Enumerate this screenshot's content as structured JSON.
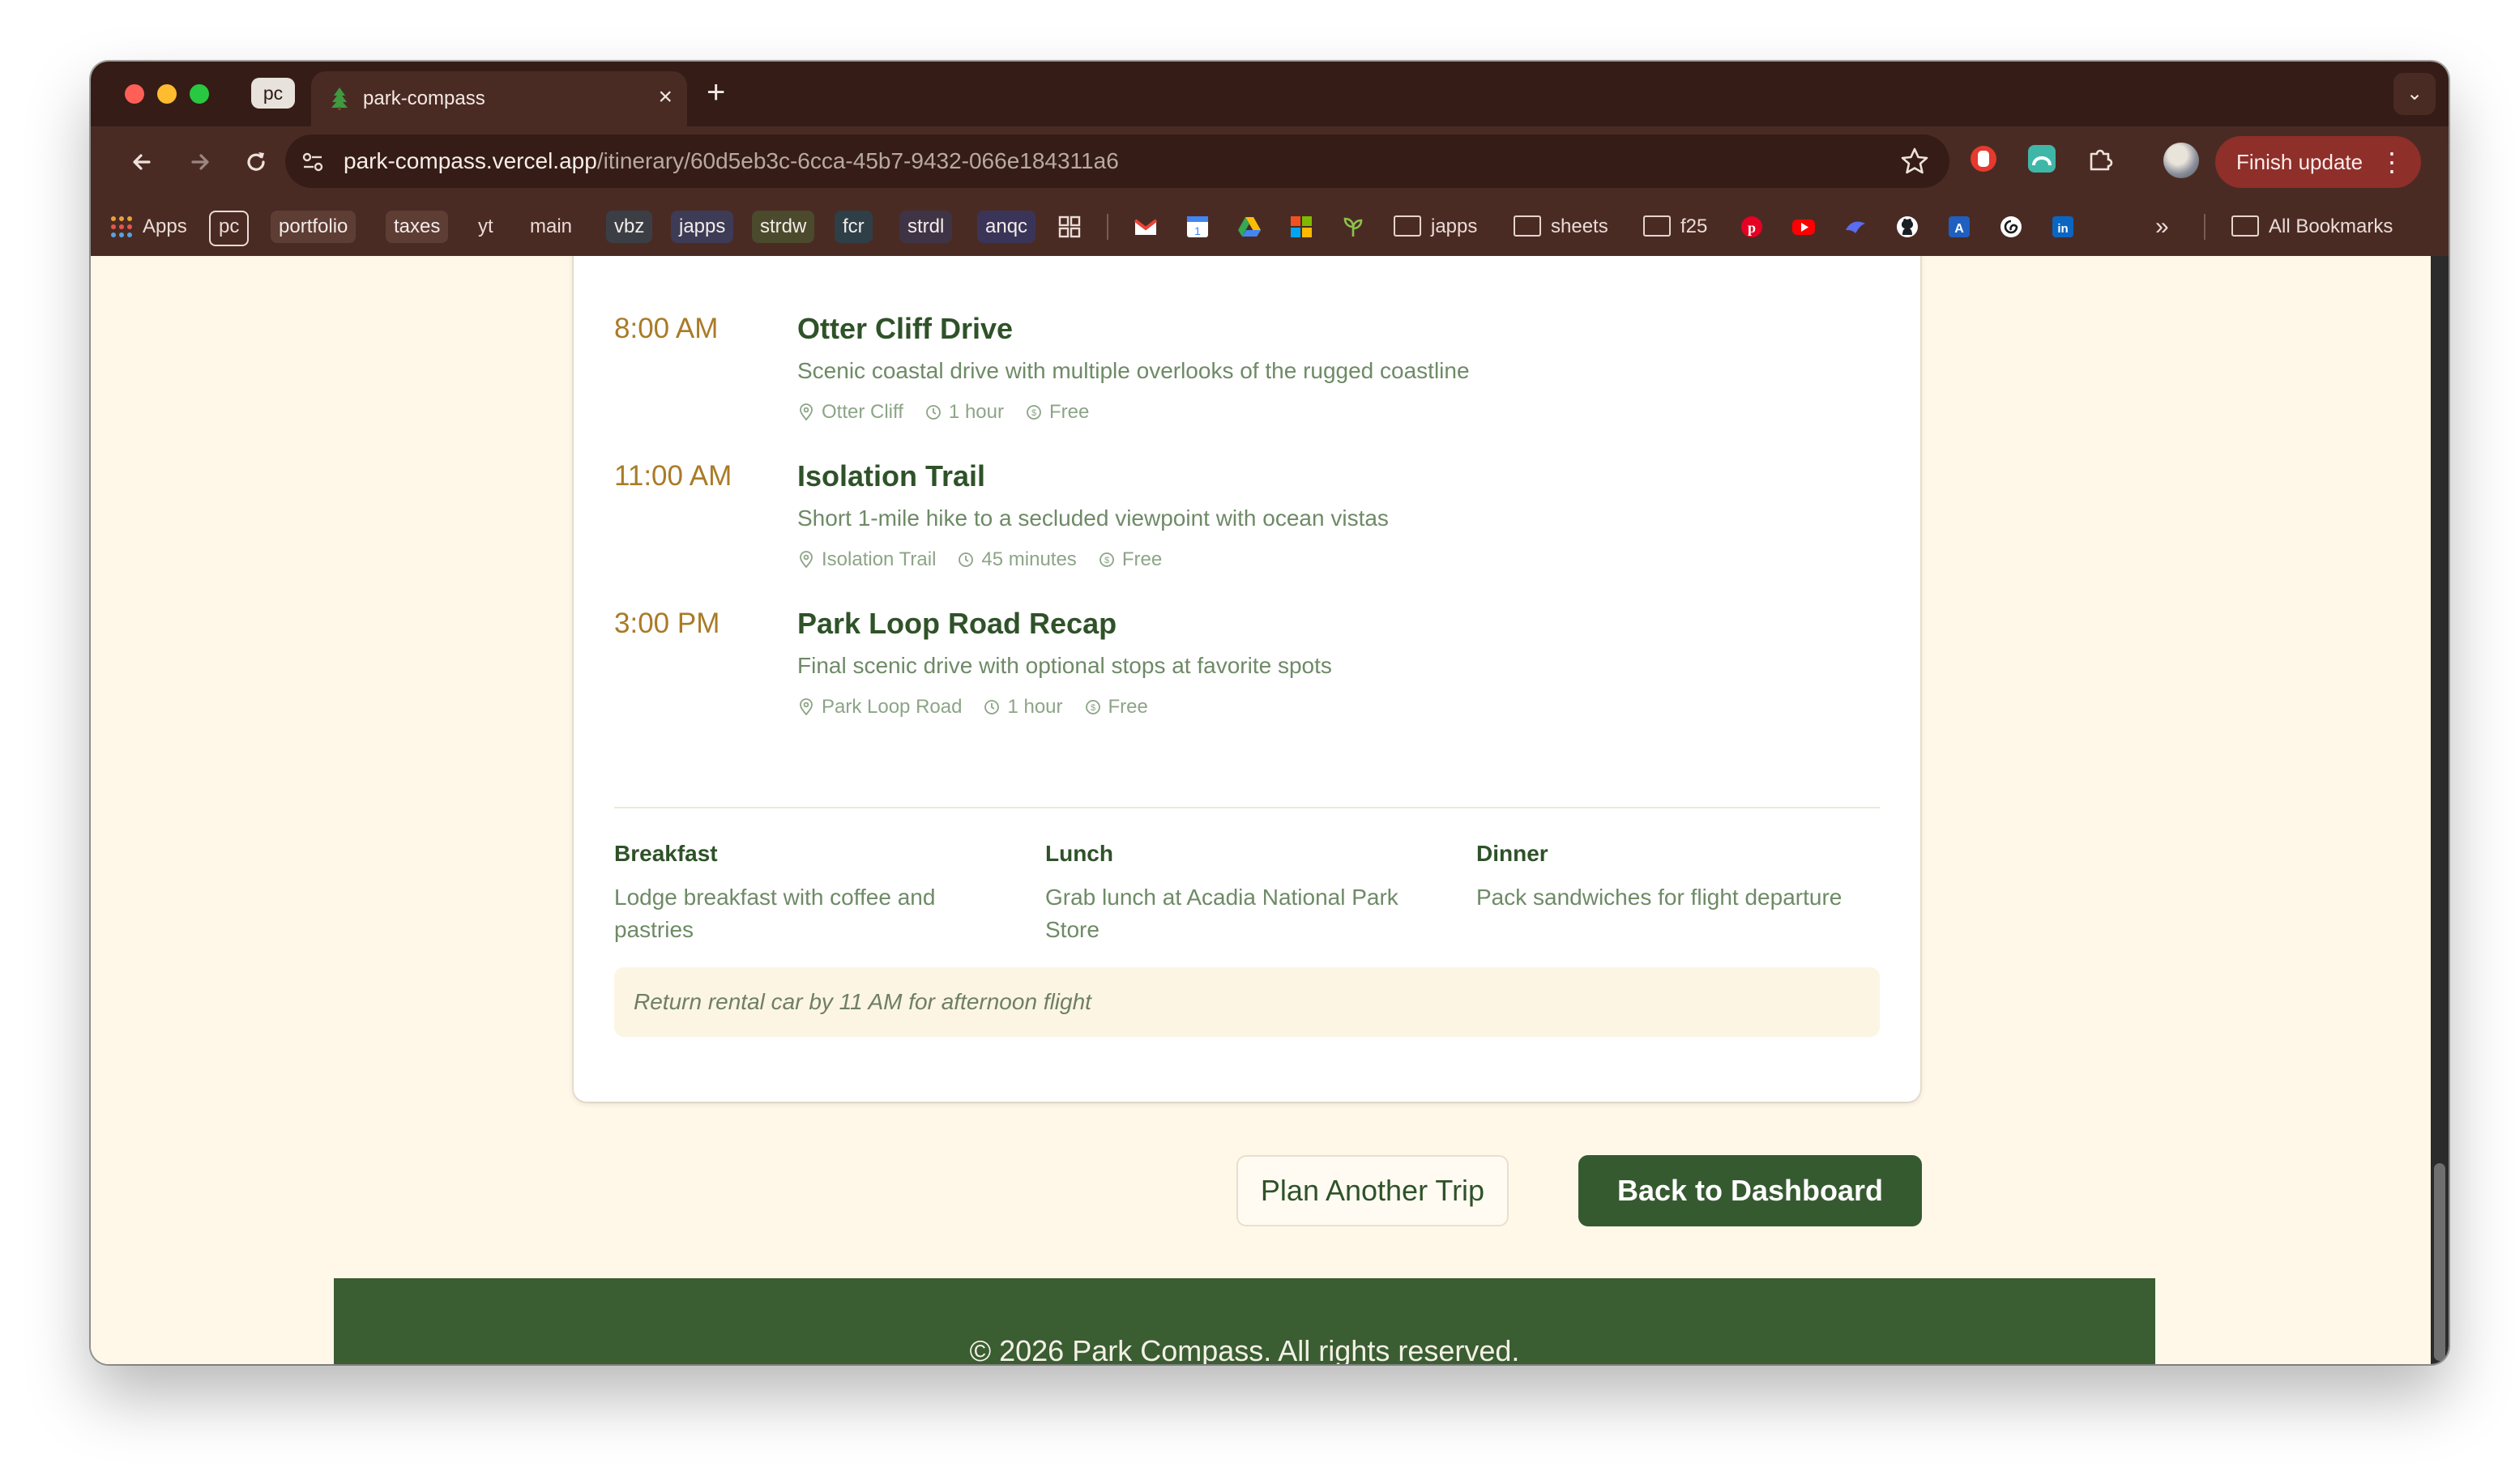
{
  "browser": {
    "group_chip": "pc",
    "tab_title": "park-compass",
    "url_host": "park-compass.vercel.app",
    "url_path": "/itinerary/60d5eb3c-6cca-45b7-9432-066e184311a6",
    "finish_update": "Finish update",
    "bookmarks": {
      "apps": "Apps",
      "pc": "pc",
      "portfolio": "portfolio",
      "taxes": "taxes",
      "yt": "yt",
      "main": "main",
      "vbz": "vbz",
      "japps": "japps",
      "strdw": "strdw",
      "fcr": "fcr",
      "strdl": "strdl",
      "anqc": "anqc",
      "folder_japps": "japps",
      "folder_sheets": "sheets",
      "folder_f25": "f25",
      "all_bookmarks": "All Bookmarks"
    }
  },
  "itinerary": {
    "activities": [
      {
        "time": "8:00 AM",
        "title": "Otter Cliff Drive",
        "description": "Scenic coastal drive with multiple overlooks of the rugged coastline",
        "location": "Otter Cliff",
        "duration": "1 hour",
        "cost": "Free"
      },
      {
        "time": "11:00 AM",
        "title": "Isolation Trail",
        "description": "Short 1-mile hike to a secluded viewpoint with ocean vistas",
        "location": "Isolation Trail",
        "duration": "45 minutes",
        "cost": "Free"
      },
      {
        "time": "3:00 PM",
        "title": "Park Loop Road Recap",
        "description": "Final scenic drive with optional stops at favorite spots",
        "location": "Park Loop Road",
        "duration": "1 hour",
        "cost": "Free"
      }
    ],
    "meals": [
      {
        "label": "Breakfast",
        "text": "Lodge breakfast with coffee and pastries"
      },
      {
        "label": "Lunch",
        "text": "Grab lunch at Acadia National Park Store"
      },
      {
        "label": "Dinner",
        "text": "Pack sandwiches for flight departure"
      }
    ],
    "note": "Return rental car by 11 AM for afternoon flight"
  },
  "actions": {
    "plan_another": "Plan Another Trip",
    "back_to_dashboard": "Back to Dashboard"
  },
  "footer": {
    "copyright": "© 2026 Park Compass. All rights reserved."
  },
  "colors": {
    "primary_green": "#365a30",
    "time_gold": "#a97b27",
    "page_cream": "#fff8e9",
    "browser_frame": "#4a2b24"
  }
}
